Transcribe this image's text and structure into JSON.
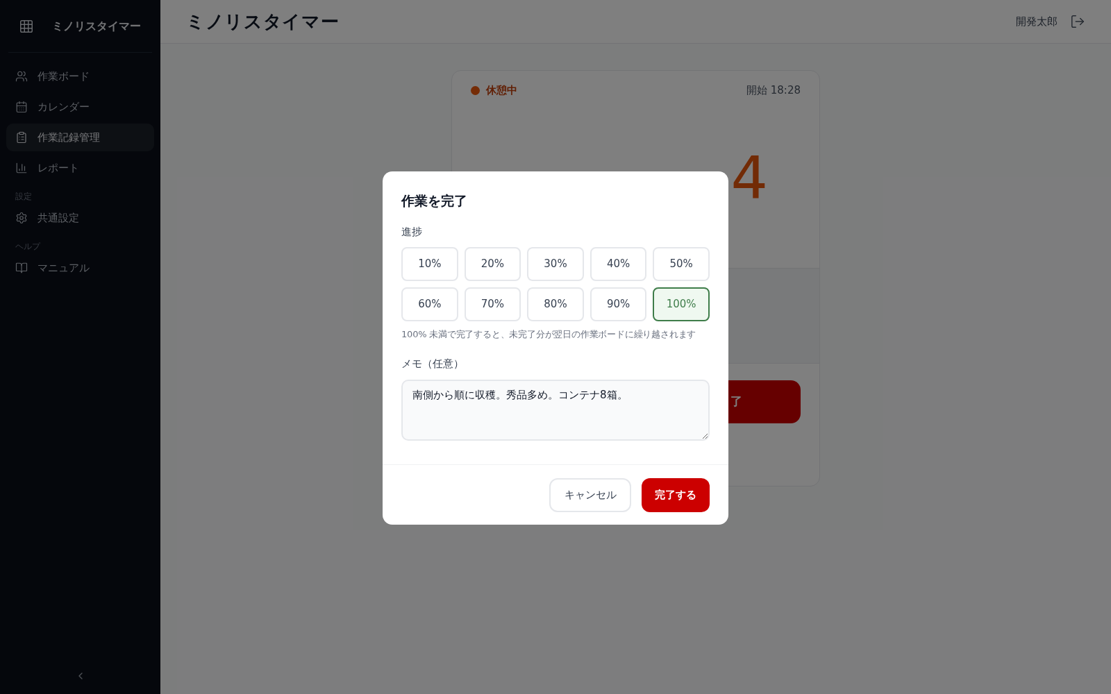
{
  "sidebar": {
    "app_name": "ミノリスタイマー",
    "sections": [
      {
        "items": [
          {
            "label": "作業ボード",
            "kind": "users",
            "selected": false
          },
          {
            "label": "カレンダー",
            "kind": "calendar",
            "selected": false
          },
          {
            "label": "作業記録管理",
            "kind": "clipboard",
            "selected": true
          },
          {
            "label": "レポート",
            "kind": "chart",
            "selected": false
          }
        ]
      },
      {
        "heading": "設定",
        "items": [
          {
            "label": "共通設定",
            "kind": "settings",
            "selected": false
          }
        ]
      },
      {
        "heading": "ヘルプ",
        "items": [
          {
            "label": "マニュアル",
            "kind": "book",
            "selected": false
          }
        ]
      }
    ]
  },
  "header": {
    "title": "ミノリスタイマー",
    "user": "開発太郎"
  },
  "timer_card": {
    "status": {
      "label": "休憩中"
    },
    "start": "開始 18:28",
    "elapsed": "4",
    "action_button": "了"
  },
  "dialog": {
    "title": "作業を完了",
    "progress_label": "進捗",
    "options": [
      {
        "label": "10%",
        "selected": false
      },
      {
        "label": "20%",
        "selected": false
      },
      {
        "label": "30%",
        "selected": false
      },
      {
        "label": "40%",
        "selected": false
      },
      {
        "label": "50%",
        "selected": false
      },
      {
        "label": "60%",
        "selected": false
      },
      {
        "label": "70%",
        "selected": false
      },
      {
        "label": "80%",
        "selected": false
      },
      {
        "label": "90%",
        "selected": false
      },
      {
        "label": "100%",
        "selected": true
      }
    ],
    "hint": "100% 未満で完了すると、未完了分が翌日の作業ボードに繰り越されます",
    "memo_label": "メモ（任意）",
    "memo": "南側から順に収穫。秀品多め。コンテナ8箱。",
    "cancel": "キャンセル",
    "confirm": "完了する"
  }
}
